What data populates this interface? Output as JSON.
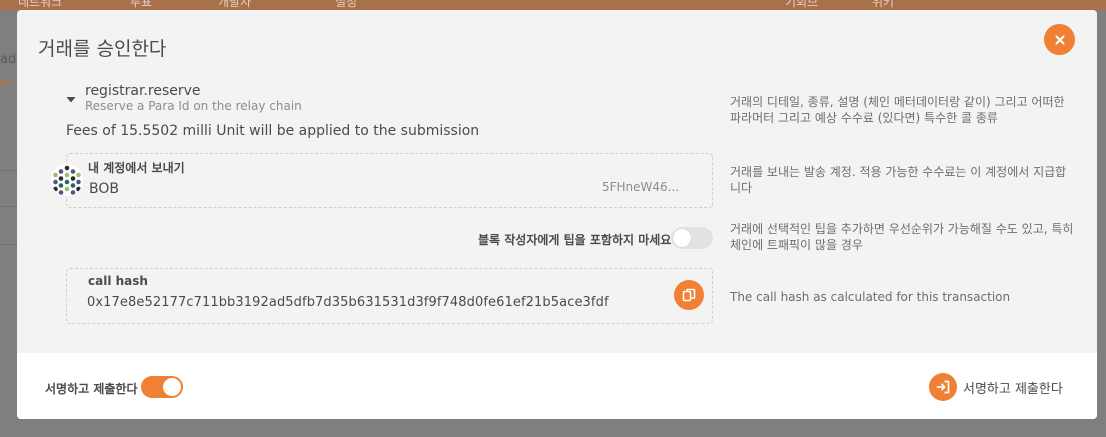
{
  "background": {
    "nav_items": [
      "네트워크",
      "투표",
      "개발자",
      "설정"
    ],
    "nav_right_items": [
      "기회브",
      "위키"
    ],
    "fragment": "ad"
  },
  "modal": {
    "title": "거래를 승인한다",
    "call": {
      "name": "registrar.reserve",
      "doc": "Reserve a Para Id on the relay chain",
      "fees": "Fees of 15.5502 milli Unit will be applied to the submission",
      "description": "거래의 디테일, 종류, 설명 (체인 메터데이터랑 같이) 그리고 어떠한 파라머터 그리고 예상 수수료 (있다면) 특수한 콜 종류"
    },
    "account": {
      "label": "내 계정에서 보내기",
      "name": "BOB",
      "address": "5FHneW46...",
      "description": "거래를 보내는 발송 계정. 적용 가능한 수수료는 이 계정에서 지급합니다"
    },
    "tip": {
      "label": "블록 작성자에게 팁을 포함하지 마세요",
      "enabled": false,
      "description": "거래에 선택적인 팁을 추가하면 우선순위가 가능해질 수도 있고, 특히 체인에 트패픽이 많을 경우"
    },
    "call_hash": {
      "label": "call hash",
      "value": "0x17e8e52177c711bb3192ad5dfb7d35b631531d3f9f748d0fe61ef21b5ace3fdf",
      "description": "The call hash as calculated for this transaction"
    },
    "footer": {
      "sign_label": "서명하고 제출한다",
      "sign_enabled": true,
      "submit_label": "서명하고 제출한다"
    }
  },
  "colors": {
    "accent": "#f08033",
    "modal_bg": "#f4f3f3",
    "overlay": "#7f7f7f"
  },
  "icons": {
    "close": "close-icon",
    "copy": "copy-icon",
    "submit": "sign-in-icon",
    "expand": "caret-down-icon"
  }
}
